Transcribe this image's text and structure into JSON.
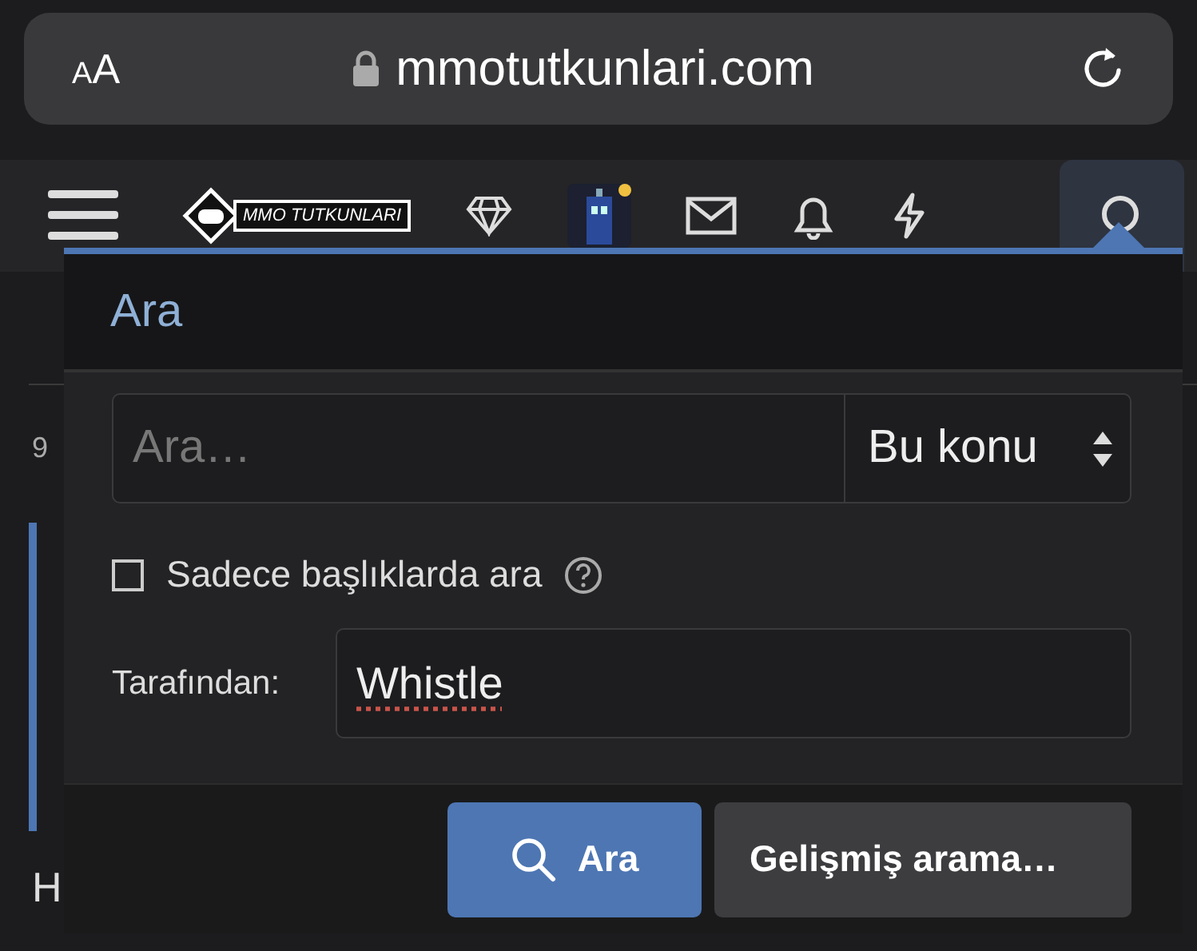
{
  "browser": {
    "text_size_button": "AA",
    "url": "mmotutkunlari.com"
  },
  "nav": {
    "logo_text": "MMO TUTKUNLARI",
    "search_active": true
  },
  "background": {
    "texts": [
      "9",
      "H"
    ]
  },
  "search_popup": {
    "title": "Ara",
    "keywords": {
      "placeholder": "Ara…"
    },
    "scope": "Bu konu",
    "titles_only": {
      "label": "Sadece başlıklarda ara",
      "checked": false
    },
    "by_member": {
      "label": "Tarafından:",
      "value": "Whistle"
    },
    "buttons": [
      {
        "kind": "primary",
        "label": "Ara"
      },
      {
        "kind": "secondary",
        "label": "Gelişmiş arama…"
      }
    ]
  }
}
